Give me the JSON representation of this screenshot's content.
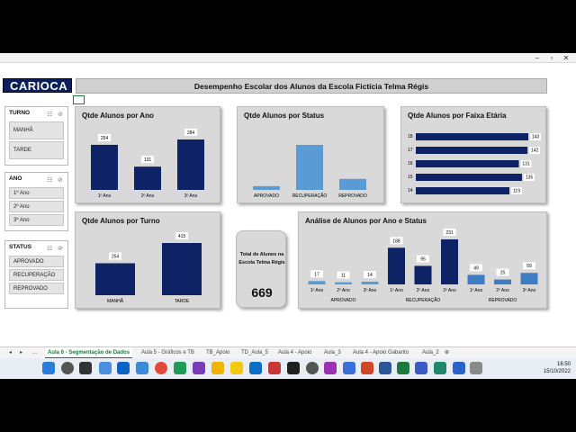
{
  "logo": "CARIOCA",
  "header": {
    "title": "Desempenho Escolar dos Alunos da Escola Fictícia Telma Régis"
  },
  "slicers": {
    "turno": {
      "title": "TURNO",
      "items": [
        "MANHÃ",
        "TARDE"
      ]
    },
    "ano": {
      "title": "ANO",
      "items": [
        "1º Ano",
        "2º Ano",
        "3º Ano"
      ]
    },
    "status": {
      "title": "STATUS",
      "items": [
        "APROVADO",
        "RECUPERAÇÃO",
        "REPROVADO"
      ]
    }
  },
  "total": {
    "label": "Total de Alunos na Escola Telma Régis",
    "value": "669"
  },
  "tabs": [
    "Aula 6 - Segmentação de Dados",
    "Aula 5 - Gráficos e TB",
    "TB_Apoio",
    "TD_Aula_5",
    "Aula 4 - Apoio",
    "Aula_3",
    "Aula 4 - Apoio Gabarito",
    "Aula_2"
  ],
  "tab_nav": {
    "prev": "◂",
    "next": "▸",
    "more": "..."
  },
  "clock": {
    "time": "16:50",
    "date": "15/10/2022"
  },
  "colors": {
    "navy": "#0d2366",
    "light_blue": "#5b9bd5",
    "mid_blue": "#3e7cc4"
  },
  "chart_data": [
    {
      "type": "bar",
      "title": "Qtde Alunos por Ano",
      "categories": [
        "1º Ano",
        "2º Ano",
        "3º Ano"
      ],
      "values": [
        254,
        131,
        284
      ],
      "color": "#0d2366"
    },
    {
      "type": "bar",
      "title": "Qtde Alunos por Status",
      "categories": [
        "APROVADO",
        "RECUPERAÇÃO",
        "REPROVADO"
      ],
      "values": [
        42,
        504,
        123
      ],
      "color": "#5b9bd5"
    },
    {
      "type": "bar",
      "orientation": "horizontal",
      "title": "Qtde Alunos por Faixa Etária",
      "categories": [
        "18",
        "17",
        "16",
        "15",
        "14"
      ],
      "values": [
        143,
        142,
        131,
        135,
        119
      ],
      "color": "#0d2366"
    },
    {
      "type": "bar",
      "title": "Qtde Alunos por Turno",
      "categories": [
        "MANHÃ",
        "TARDE"
      ],
      "values": [
        254,
        415
      ],
      "color": "#0d2366"
    },
    {
      "type": "bar",
      "title": "Análise de Alunos por Ano e Status",
      "groups": [
        "APROVADO",
        "RECUPERAÇÃO",
        "REPROVADO"
      ],
      "categories": [
        "1º Ano",
        "2º Ano",
        "3º Ano",
        "1º Ano",
        "2º Ano",
        "3º Ano",
        "1º Ano",
        "2º Ano",
        "3º Ano"
      ],
      "values": [
        17,
        11,
        14,
        188,
        95,
        231,
        49,
        25,
        59
      ],
      "colors": [
        "#5b9bd5",
        "#5b9bd5",
        "#5b9bd5",
        "#0d2366",
        "#0d2366",
        "#0d2366",
        "#3e7cc4",
        "#3e7cc4",
        "#3e7cc4"
      ]
    }
  ]
}
